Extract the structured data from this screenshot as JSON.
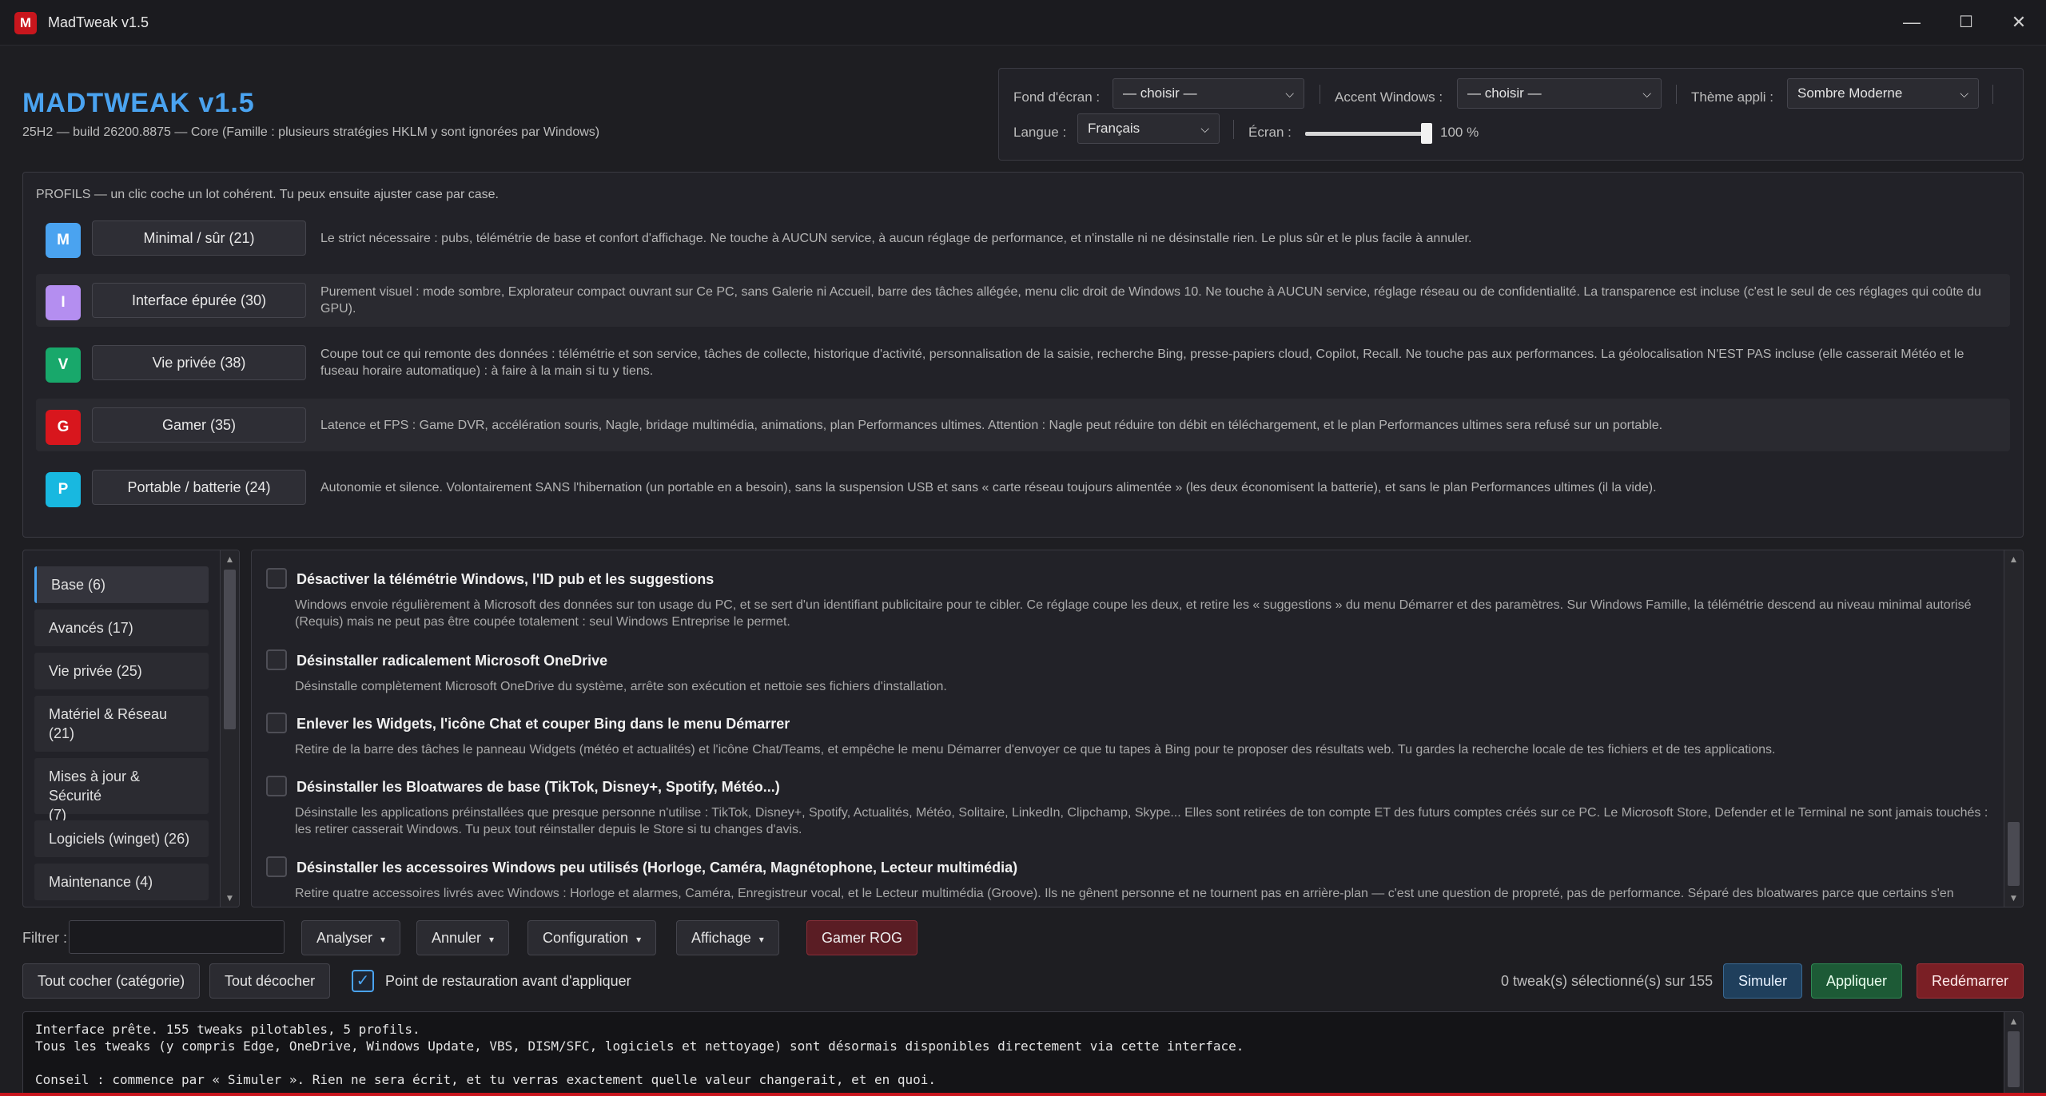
{
  "window": {
    "title": "MadTweak v1.5",
    "icon_letter": "M",
    "controls": {
      "minimize": "—",
      "maximize": "☐",
      "close": "✕"
    }
  },
  "header": {
    "brand": "MADTWEAK  v1.5",
    "build_info": "25H2 — build 26200.8875 — Core  (Famille : plusieurs stratégies HKLM y sont ignorées par Windows)"
  },
  "settings": {
    "wallpaper_label": "Fond d'écran :",
    "wallpaper_value": "— choisir —",
    "accent_label": "Accent Windows :",
    "accent_value": "— choisir —",
    "theme_label": "Thème appli :",
    "theme_value": "Sombre Moderne",
    "language_label": "Langue :",
    "language_value": "Français",
    "screen_label": "Écran :",
    "screen_value": "100 %",
    "screen_slider_level": 1.0
  },
  "profiles": {
    "intro": "PROFILS — un clic coche un lot cohérent. Tu peux ensuite ajuster case par case.",
    "items": [
      {
        "letter": "M",
        "color": "#4aa3f0",
        "label": "Minimal / sûr  (21)",
        "desc": "Le strict nécessaire : pubs, télémétrie de base et confort d'affichage. Ne touche à AUCUN service, à aucun réglage de performance, et n'installe ni ne désinstalle rien. Le plus sûr et le plus facile à annuler."
      },
      {
        "letter": "I",
        "color": "#b48ef0",
        "label": "Interface épurée  (30)",
        "desc": "Purement visuel : mode sombre, Explorateur compact ouvrant sur Ce PC, sans Galerie ni Accueil, barre des tâches allégée, menu clic droit de Windows 10. Ne touche à AUCUN service, réglage réseau ou de confidentialité. La transparence est incluse (c'est le seul de ces réglages qui coûte du GPU)."
      },
      {
        "letter": "V",
        "color": "#18a86b",
        "label": "Vie privée  (38)",
        "desc": "Coupe tout ce qui remonte des données : télémétrie et son service, tâches de collecte, historique d'activité, personnalisation de la saisie, recherche Bing, presse-papiers cloud, Copilot, Recall. Ne touche pas aux performances. La géolocalisation N'EST PAS incluse (elle casserait Météo et le fuseau horaire automatique) : à faire à la main si tu y tiens."
      },
      {
        "letter": "G",
        "color": "#d8161d",
        "label": "Gamer  (35)",
        "desc": "Latence et FPS : Game DVR, accélération souris, Nagle, bridage multimédia, animations, plan Performances ultimes. Attention : Nagle peut réduire ton débit en téléchargement, et le plan Performances ultimes sera refusé sur un portable."
      },
      {
        "letter": "P",
        "color": "#18b8e0",
        "label": "Portable / batterie  (24)",
        "desc": "Autonomie et silence. Volontairement SANS l'hibernation (un portable en a besoin), sans la suspension USB et sans « carte réseau toujours alimentée » (les deux économisent la batterie), et sans le plan Performances ultimes (il la vide)."
      }
    ]
  },
  "categories": [
    {
      "label": "Base  (6)",
      "selected": true
    },
    {
      "label": "Avancés  (17)"
    },
    {
      "label": "Vie privée  (25)"
    },
    {
      "label": "Matériel & Réseau\n(21)"
    },
    {
      "label": "Mises à jour & Sécurité\n(7)"
    },
    {
      "label": "Logiciels (winget)  (26)"
    },
    {
      "label": "Maintenance  (4)"
    }
  ],
  "tweaks": [
    {
      "title": "Désactiver la télémétrie Windows, l'ID pub et les suggestions",
      "desc": "Windows envoie régulièrement à Microsoft des données sur ton usage du PC, et se sert d'un identifiant publicitaire pour te cibler. Ce réglage coupe les deux, et retire les « suggestions » du menu Démarrer et des paramètres. Sur Windows Famille, la télémétrie descend au niveau minimal autorisé (Requis) mais ne peut pas être coupée totalement : seul Windows Entreprise le permet."
    },
    {
      "title": "Désinstaller radicalement Microsoft OneDrive",
      "desc": "Désinstalle complètement Microsoft OneDrive du système, arrête son exécution et nettoie ses fichiers d'installation."
    },
    {
      "title": "Enlever les Widgets, l'icône Chat et couper Bing dans le menu Démarrer",
      "desc": "Retire de la barre des tâches le panneau Widgets (météo et actualités) et l'icône Chat/Teams, et empêche le menu Démarrer d'envoyer ce que tu tapes à Bing pour te proposer des résultats web. Tu gardes la recherche locale de tes fichiers et de tes applications."
    },
    {
      "title": "Désinstaller les Bloatwares de base (TikTok, Disney+, Spotify, Météo...)",
      "desc": "Désinstalle les applications préinstallées que presque personne n'utilise : TikTok, Disney+, Spotify, Actualités, Météo, Solitaire, LinkedIn, Clipchamp, Skype... Elles sont retirées de ton compte ET des futurs comptes créés sur ce PC. Le Microsoft Store, Defender et le Terminal ne sont jamais touchés : les retirer casserait Windows. Tu peux tout réinstaller depuis le Store si tu changes d'avis."
    },
    {
      "title": "Désinstaller les accessoires Windows peu utilisés (Horloge, Caméra, Magnétophone, Lecteur multimédia)",
      "desc": "Retire quatre accessoires livrés avec Windows : Horloge et alarmes, Caméra, Enregistreur vocal, et le Lecteur multimédia (Groove). Ils ne gênent personne et ne tournent pas en arrière-plan — c'est une question de propreté, pas de performance. Séparé des bloatwares parce que certains s'en"
    }
  ],
  "toolbar": {
    "filter_label": "Filtrer :",
    "filter_value": "",
    "analyze": "Analyser",
    "undo": "Annuler",
    "configuration": "Configuration",
    "display": "Affichage",
    "gamer_rog": "Gamer ROG",
    "caret": "▾"
  },
  "actions": {
    "check_all": "Tout cocher (catégorie)",
    "uncheck_all": "Tout décocher",
    "restore_point_label": "Point de restauration avant d'appliquer",
    "restore_point_checked": true,
    "selected_count": "0 tweak(s) sélectionné(s) sur 155",
    "simulate": "Simuler",
    "apply": "Appliquer",
    "reboot": "Redémarrer"
  },
  "console": {
    "lines": [
      "Interface prête. 155 tweaks pilotables, 5 profils.",
      "Tous les tweaks (y compris Edge, OneDrive, Windows Update, VBS, DISM/SFC, logiciels et nettoyage) sont désormais disponibles directement via cette interface.",
      "",
      "Conseil : commence par « Simuler ». Rien ne sera écrit, et tu verras exactement quelle valeur changerait, et en quoi."
    ]
  }
}
